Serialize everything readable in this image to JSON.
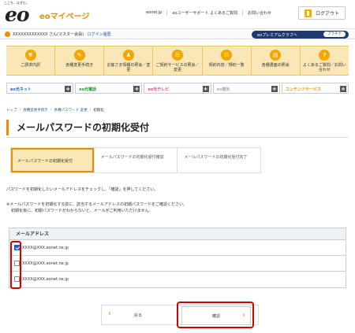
{
  "header": {
    "tagline": "ここち、はずむ。",
    "logo_text": "eo",
    "mypage_label": "eoマイページ",
    "links": [
      "eonet.jp",
      "eoユーザーサポート",
      "よくあるご質問",
      "お問い合わせ"
    ],
    "logout_label": "ログアウト"
  },
  "userbar": {
    "user_name": "XXXXXXXXXXXXX さん(マスター会員)",
    "login_history": "ログイン履歴",
    "premium_label": "eoプレミアムクラブへ",
    "premium_rank": "プラチナ"
  },
  "menu": [
    {
      "icon": "¥",
      "label": "ご請求内訳"
    },
    {
      "icon": "✎",
      "label": "各種変更手続き"
    },
    {
      "icon": "♟",
      "label": "お客さま情報の照会／変更"
    },
    {
      "icon": "☰",
      "label": "ご契約サービスの照会／変更"
    },
    {
      "icon": "☷",
      "label": "契約内容／規約一覧"
    },
    {
      "icon": "▤",
      "label": "各種書面の照会"
    },
    {
      "icon": "?",
      "label": "よくあるご質問／お問い合わせ"
    }
  ],
  "services": [
    {
      "name": "eo光ネット",
      "color": "#1a62c9"
    },
    {
      "name": "eo光電話",
      "color": "#1a9a3a"
    },
    {
      "name": "eo光テレビ",
      "color": "#e04a8a"
    },
    {
      "name": "eo電気",
      "color": "#aaaaaa"
    },
    {
      "name": "コンテンツサービス",
      "color": "#f08c00"
    }
  ],
  "breadcrumb": [
    "トップ",
    "各種変更手続き",
    "各種パスワード 変更",
    "初期化"
  ],
  "page_title": "メールパスワードの初期化受付",
  "steps": [
    "メールパスワードの初期化受付",
    "メールパスワードの初期化受付確認",
    "メールパスワードの初期化受付完了"
  ],
  "instruction": "パスワードを初期化したいメールアドレスをチェックし、「確認」を押してください。",
  "notes": [
    "※メールパスワードを初期化する前に、該当するメールアドレスの初期パスワードをご確認ください。",
    "初期化後に、初期パスワードがわからないと、メールがご利用いただけません。"
  ],
  "mail_table": {
    "header": "メールアドレス",
    "rows": [
      {
        "address": "XXXX@XXX.eonet.ne.jp",
        "checked": true
      },
      {
        "address": "XXXX@XXX.eonet.ne.jp",
        "checked": false
      },
      {
        "address": "XXXX@XXX.eonet.ne.jp",
        "checked": false
      }
    ]
  },
  "buttons": {
    "back_label": "戻る",
    "confirm_label": "確認"
  },
  "colors": {
    "accent": "#f08c00",
    "highlight": "#d20000",
    "premium": "#1e3a6e"
  }
}
